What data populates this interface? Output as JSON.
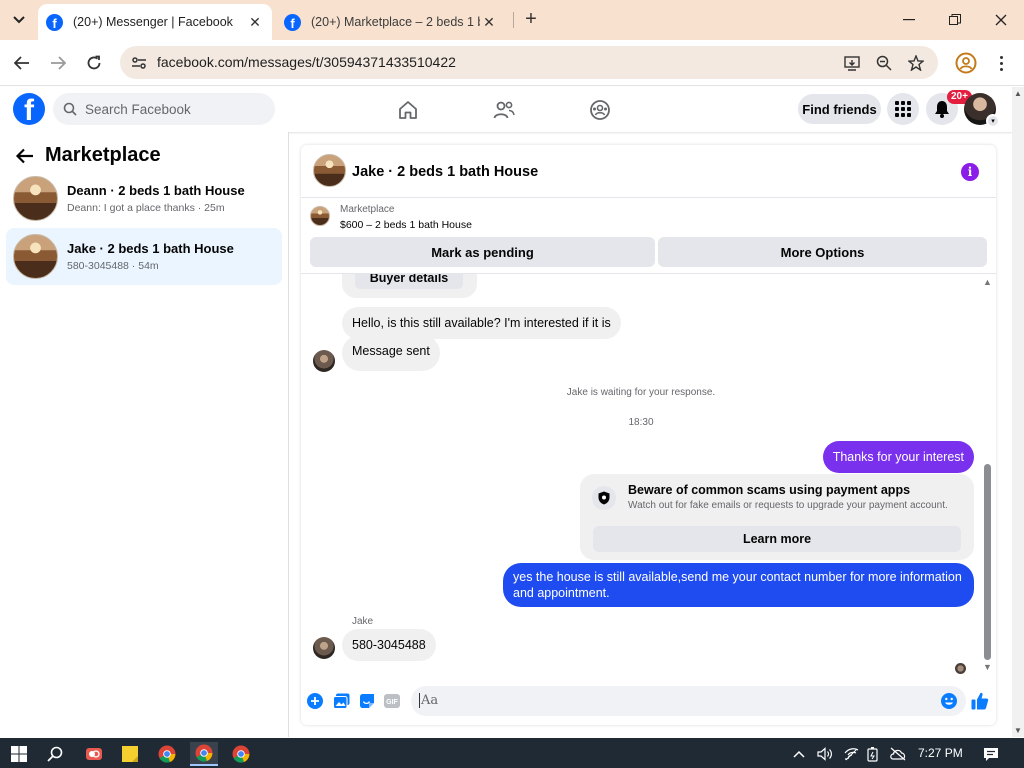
{
  "browser": {
    "tabs": [
      {
        "title": "(20+) Messenger | Facebook",
        "active": true
      },
      {
        "title": "(20+) Marketplace – 2 beds 1 b",
        "active": false
      }
    ],
    "url": "facebook.com/messages/t/30594371433510422"
  },
  "fb_header": {
    "search_placeholder": "Search Facebook",
    "find_friends": "Find friends",
    "notification_badge": "20+"
  },
  "sidebar": {
    "title": "Marketplace",
    "conversations": [
      {
        "name": "Deann · 2 beds 1 bath House",
        "preview": "Deann: I got a place thanks · 25m",
        "selected": false
      },
      {
        "name": "Jake · 2 beds 1 bath House",
        "preview": "580-3045488 · 54m",
        "selected": true
      }
    ]
  },
  "chat": {
    "title": "Jake · 2 beds 1 bath House",
    "listing_label": "Marketplace",
    "listing_price": "$600 – 2 beds 1 bath House",
    "mark_pending": "Mark as pending",
    "more_options": "More Options",
    "buyer_details": "Buyer details",
    "messages": {
      "m1": "Hello, is this still available? I'm interested if it is",
      "m2": "Message sent",
      "waiting": "Jake is waiting for your response.",
      "time": "18:30",
      "m3": "Thanks for your interest",
      "scam_title": "Beware of common scams using payment apps",
      "scam_body": "Watch out for fake emails or requests to upgrade your payment account.",
      "learn_more": "Learn more",
      "m4": "yes the house is still available,send me your contact number for more information and appointment.",
      "sender": "Jake",
      "m5": "580-3045488"
    },
    "composer_placeholder": "Aa"
  },
  "taskbar": {
    "clock": "7:27 PM"
  },
  "colors": {
    "fb_blue": "#0866ff",
    "outgoing_purple": "#7a31ee",
    "outgoing_blue": "#1f4cf0",
    "selected_row": "#ebf5ff"
  }
}
